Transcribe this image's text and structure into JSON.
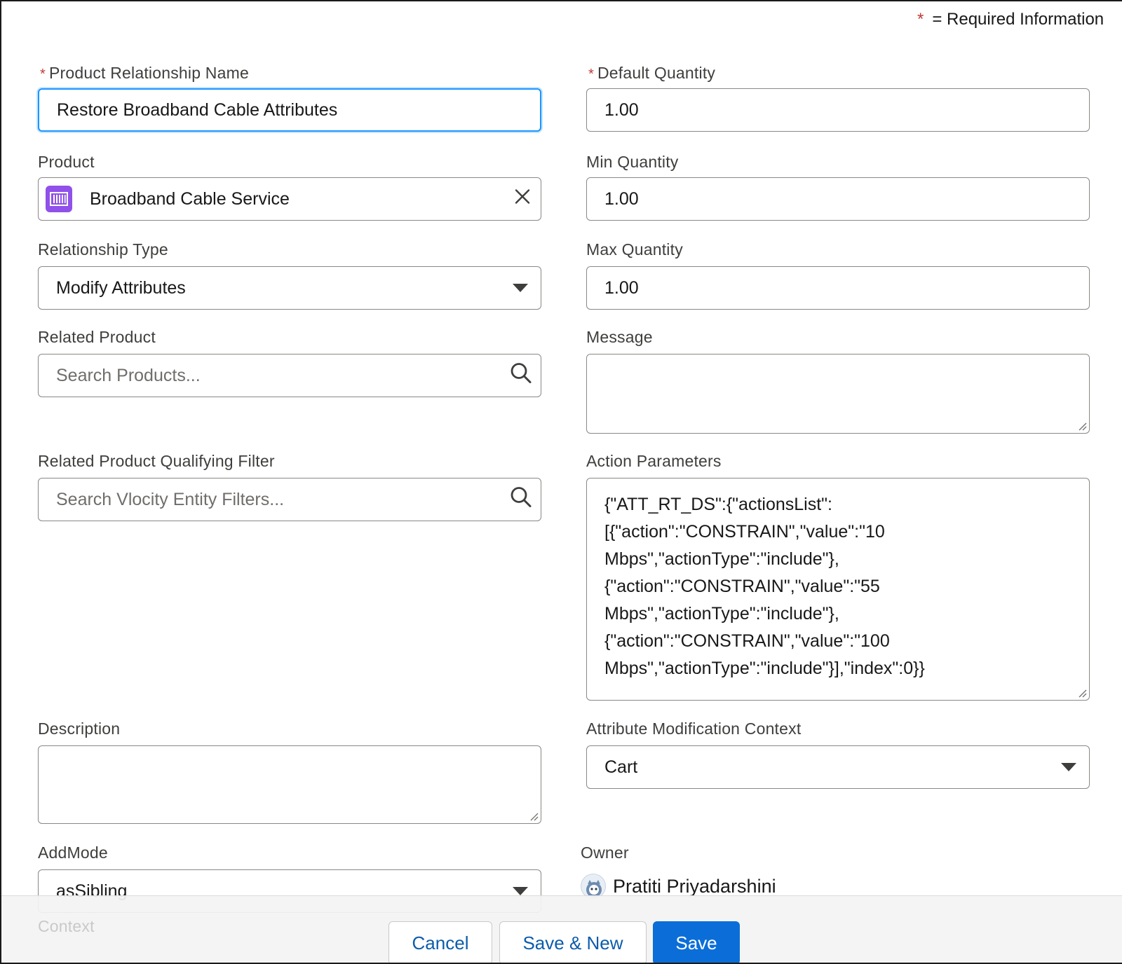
{
  "required_note": {
    "star": "*",
    "text": "= Required Information"
  },
  "left": {
    "relationship_name": {
      "label": "Product Relationship Name",
      "required": "*",
      "value": "Restore Broadband Cable Attributes"
    },
    "product": {
      "label": "Product",
      "value": "Broadband Cable Service",
      "icon": "product-icon",
      "clear_icon": "close-icon"
    },
    "relationship_type": {
      "label": "Relationship Type",
      "value": "Modify Attributes"
    },
    "related_product": {
      "label": "Related Product",
      "placeholder": "Search Products..."
    },
    "qualifying_filter": {
      "label": "Related Product Qualifying Filter",
      "placeholder": "Search Vlocity Entity Filters..."
    },
    "description": {
      "label": "Description",
      "value": ""
    },
    "add_mode": {
      "label": "AddMode",
      "value": "asSibling"
    },
    "context": {
      "label": "Context"
    }
  },
  "right": {
    "default_quantity": {
      "label": "Default Quantity",
      "required": "*",
      "value": "1.00"
    },
    "min_quantity": {
      "label": "Min Quantity",
      "value": "1.00"
    },
    "max_quantity": {
      "label": "Max Quantity",
      "value": "1.00"
    },
    "message": {
      "label": "Message",
      "value": ""
    },
    "action_parameters": {
      "label": "Action Parameters",
      "value": "{\"ATT_RT_DS\":{\"actionsList\":\n[{\"action\":\"CONSTRAIN\",\"value\":\"10\nMbps\",\"actionType\":\"include\"},\n{\"action\":\"CONSTRAIN\",\"value\":\"55\nMbps\",\"actionType\":\"include\"},\n{\"action\":\"CONSTRAIN\",\"value\":\"100\nMbps\",\"actionType\":\"include\"}],\"index\":0}}"
    },
    "attr_mod_context": {
      "label": "Attribute Modification Context",
      "value": "Cart"
    },
    "owner": {
      "label": "Owner",
      "value": "Pratiti Priyadarshini"
    }
  },
  "footer": {
    "cancel": "Cancel",
    "save_new": "Save & New",
    "save": "Save"
  },
  "colors": {
    "brand": "#0b6ed8",
    "focus": "#1b96ff",
    "required": "#c23934",
    "product_icon": "#9050e9"
  }
}
